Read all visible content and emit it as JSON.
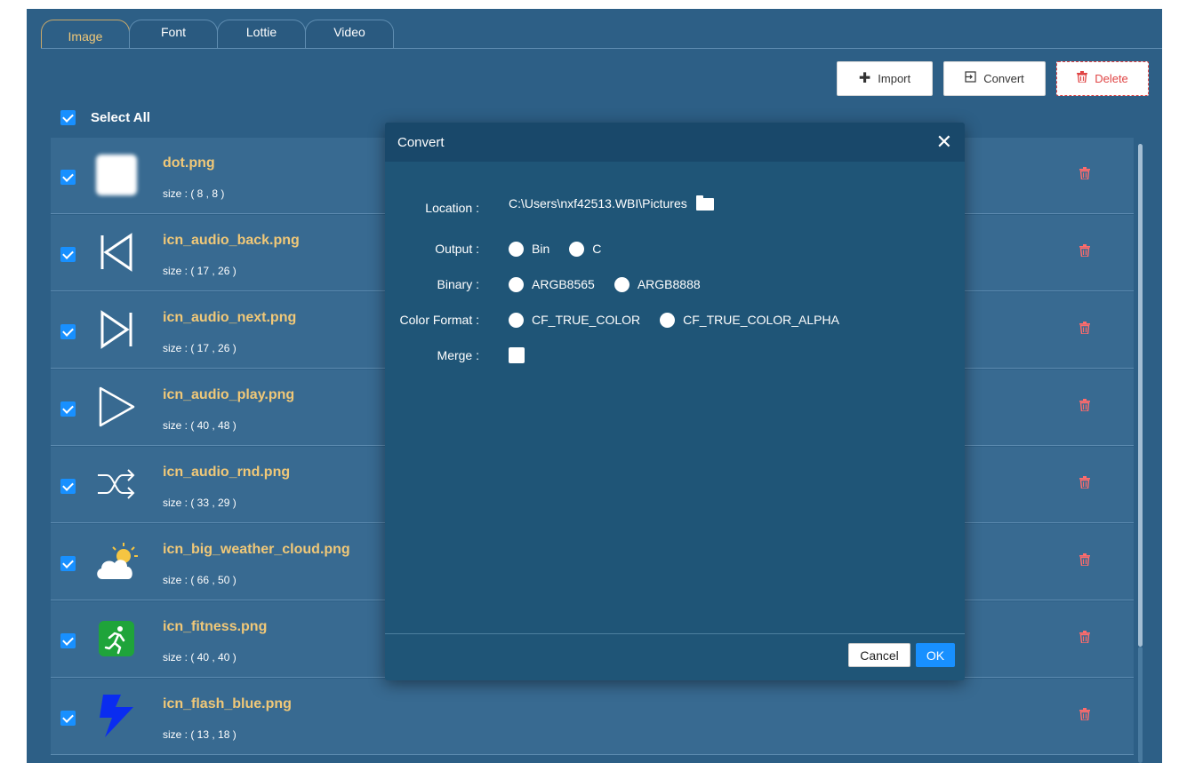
{
  "tabs": [
    {
      "label": "Image",
      "active": true
    },
    {
      "label": "Font",
      "active": false
    },
    {
      "label": "Lottie",
      "active": false
    },
    {
      "label": "Video",
      "active": false
    }
  ],
  "toolbar": {
    "import_label": "Import",
    "convert_label": "Convert",
    "delete_label": "Delete"
  },
  "select_all": {
    "label": "Select All",
    "checked": true
  },
  "files": [
    {
      "name": "dot.png",
      "size": "size : ( 8 , 8 )",
      "icon": "dot-thumbnail",
      "checked": true
    },
    {
      "name": "icn_audio_back.png",
      "size": "size : ( 17 , 26 )",
      "icon": "audio-back-icon",
      "checked": true
    },
    {
      "name": "icn_audio_next.png",
      "size": "size : ( 17 , 26 )",
      "icon": "audio-next-icon",
      "checked": true
    },
    {
      "name": "icn_audio_play.png",
      "size": "size : ( 40 , 48 )",
      "icon": "audio-play-icon",
      "checked": true
    },
    {
      "name": "icn_audio_rnd.png",
      "size": "size : ( 33 , 29 )",
      "icon": "shuffle-icon",
      "checked": true
    },
    {
      "name": "icn_big_weather_cloud.png",
      "size": "size : ( 66 , 50 )",
      "icon": "weather-cloud-icon",
      "checked": true
    },
    {
      "name": "icn_fitness.png",
      "size": "size : ( 40 , 40 )",
      "icon": "fitness-icon",
      "checked": true
    },
    {
      "name": "icn_flash_blue.png",
      "size": "size : ( 13 , 18 )",
      "icon": "flash-icon",
      "checked": true
    }
  ],
  "dialog": {
    "title": "Convert",
    "location_label": "Location :",
    "location_value": "C:\\Users\\nxf42513.WBI\\Pictures",
    "output_label": "Output :",
    "output_options": [
      "Bin",
      "C"
    ],
    "binary_label": "Binary :",
    "binary_options": [
      "ARGB8565",
      "ARGB8888"
    ],
    "color_format_label": "Color Format :",
    "color_format_options": [
      "CF_TRUE_COLOR",
      "CF_TRUE_COLOR_ALPHA"
    ],
    "merge_label": "Merge :",
    "cancel_label": "Cancel",
    "ok_label": "OK"
  },
  "colors": {
    "background": "#2d5f86",
    "row": "#386a91",
    "file_name": "#f0c878",
    "accent": "#1890ff",
    "danger": "#e04545",
    "dialog": "#1f5577"
  }
}
